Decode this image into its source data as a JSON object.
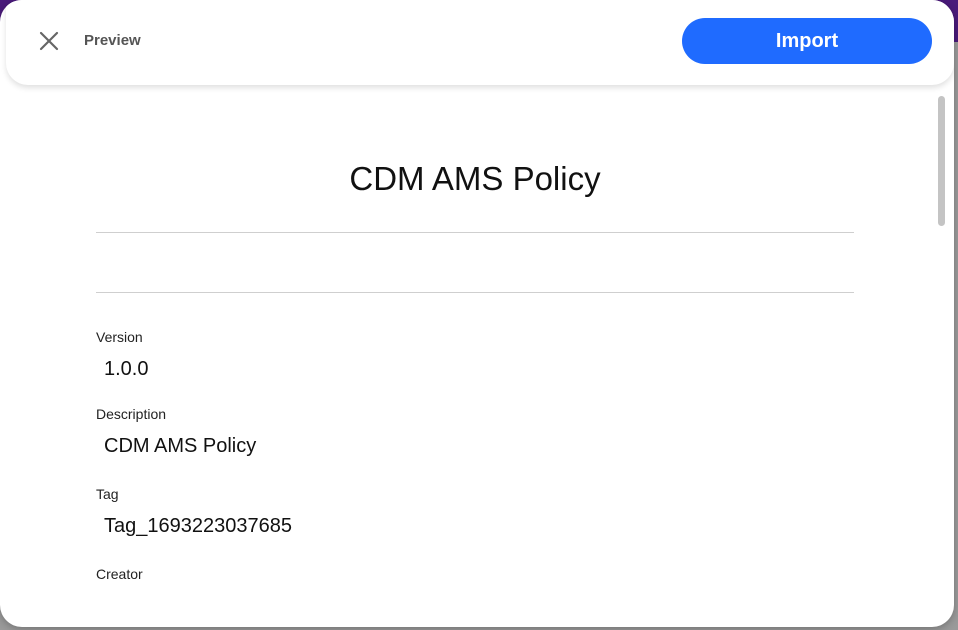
{
  "header": {
    "title": "Preview",
    "import_label": "Import"
  },
  "policy": {
    "title": "CDM AMS Policy"
  },
  "fields": [
    {
      "label": "Version",
      "value": "1.0.0"
    },
    {
      "label": "Description",
      "value": "CDM AMS Policy"
    },
    {
      "label": "Tag",
      "value": "Tag_1693223037685"
    },
    {
      "label": "Creator",
      "value": ""
    }
  ],
  "colors": {
    "accent": "#1f6bff",
    "background_topbar": "#4a1a7a"
  },
  "icons": {
    "close": "close-icon"
  }
}
